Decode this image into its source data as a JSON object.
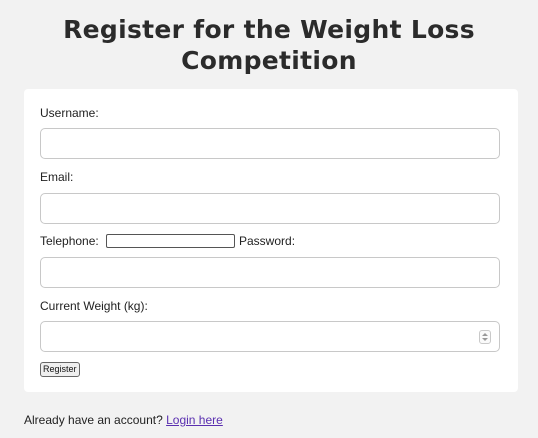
{
  "page": {
    "title": "Register for the Weight Loss Competition"
  },
  "form": {
    "username_label": "Username:",
    "username_value": "",
    "email_label": "Email:",
    "email_value": "",
    "telephone_label": "Telephone:",
    "telephone_value": "",
    "password_label": "Password:",
    "password_value": "",
    "weight_label": "Current Weight (kg):",
    "weight_value": "",
    "submit_label": "Register"
  },
  "footer": {
    "prompt": "Already have an account?",
    "login_link": "Login here"
  },
  "icons": {
    "spinner": "number-spinner-icon"
  },
  "colors": {
    "background": "#f2f2f2",
    "card": "#ffffff",
    "link": "#5a2fb0",
    "title": "#2b2b2b"
  }
}
